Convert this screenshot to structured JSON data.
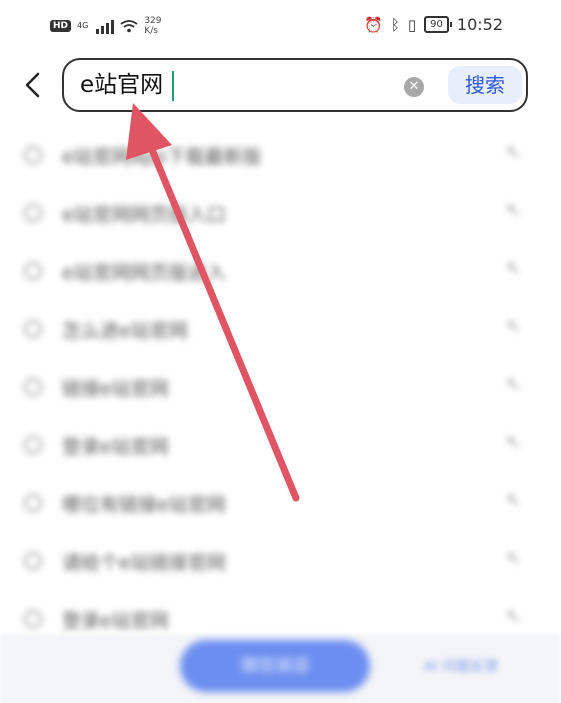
{
  "status_bar": {
    "hd_badge": "HD",
    "network": "4G",
    "speed_value": "329",
    "speed_unit": "K/s",
    "battery": "90",
    "time": "10:52",
    "icons": [
      "hd-icon",
      "signal-icon",
      "wifi-icon",
      "alarm-icon",
      "bluetooth-icon",
      "vibrate-icon",
      "battery-icon"
    ]
  },
  "search": {
    "query": "e站官网",
    "search_label": "搜索",
    "clear_icon": "close-circle-icon",
    "back_icon": "chevron-left-icon"
  },
  "suggestions": [
    {
      "text": "e站官网app下载最新版",
      "arrow": "↖"
    },
    {
      "text": "e站官网网页版入口",
      "arrow": "↖"
    },
    {
      "text": "e站官网网页版进入",
      "arrow": "↖"
    },
    {
      "text": "怎么进e站官网",
      "arrow": "↖"
    },
    {
      "text": "链接e站官网",
      "arrow": "↖"
    },
    {
      "text": "登录e站官网",
      "arrow": "↖"
    },
    {
      "text": "哪位有链接e站官网",
      "arrow": "↖"
    },
    {
      "text": "请给个e站链接官网",
      "arrow": "↖"
    },
    {
      "text": "登录e站官网",
      "arrow": "↖"
    }
  ],
  "bottom": {
    "voice_label": "按住说话",
    "feedback": "AI 问题反馈"
  },
  "colors": {
    "accent": "#2e5bd6",
    "search_button_bg": "#e8eefc",
    "annotation_arrow": "#e05563",
    "cursor": "#1f9d7a"
  }
}
